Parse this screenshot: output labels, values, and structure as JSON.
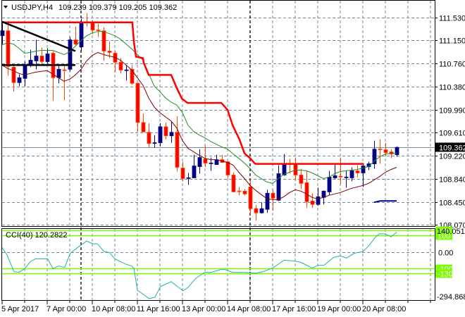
{
  "header": {
    "symbol_label": "USDJPY,H4",
    "ohlc": "109.239 109.379 109.205 109.362"
  },
  "colors": {
    "bull": "#000080",
    "bear_fill": "#ff0000",
    "bear_wick": "#ff4500",
    "stop_line": "#ff0000",
    "fast_ma": "#228b22",
    "slow_ma": "#800000",
    "trendline": "#000000",
    "cci_line": "#20b2aa",
    "cci_level": "#7cfc00",
    "grid": "#778899",
    "price_line": "#778899"
  },
  "chart_data": {
    "type": "candlestick",
    "symbol": "USDJPY",
    "timeframe": "H4",
    "ylim": [
      108.047,
      111.81
    ],
    "price_axis": {
      "ticks": [
        "111.530",
        "111.150",
        "110.760",
        "110.380",
        "109.990",
        "109.610",
        "109.220",
        "108.840",
        "108.450",
        "108.070"
      ]
    },
    "current_price": "109.362",
    "x_labels": [
      {
        "index": 0,
        "label": "5 Apr 2017"
      },
      {
        "index": 8,
        "label": "7 Apr 00:00"
      },
      {
        "index": 16,
        "label": "10 Apr 08:00"
      },
      {
        "index": 24,
        "label": "11 Apr 16:00"
      },
      {
        "index": 32,
        "label": "13 Apr 00:00"
      },
      {
        "index": 40,
        "label": "14 Apr 08:00"
      },
      {
        "index": 48,
        "label": "17 Apr 16:00"
      },
      {
        "index": 56,
        "label": "19 Apr 00:00"
      },
      {
        "index": 64,
        "label": "20 Apr 08:00"
      }
    ],
    "vertical_markers": [
      14,
      44
    ],
    "candles_ohlc": [
      [
        111.226,
        111.46,
        111.086,
        111.308
      ],
      [
        111.308,
        111.471,
        110.56,
        110.712
      ],
      [
        110.7,
        110.735,
        110.291,
        110.443
      ],
      [
        110.443,
        110.583,
        110.384,
        110.525
      ],
      [
        110.513,
        110.794,
        110.384,
        110.735
      ],
      [
        110.735,
        110.992,
        110.7,
        110.817
      ],
      [
        110.805,
        111.156,
        110.665,
        110.887
      ],
      [
        110.887,
        111.027,
        110.735,
        110.794
      ],
      [
        110.794,
        111.016,
        110.758,
        110.922
      ],
      [
        110.934,
        110.969,
        110.139,
        110.525
      ],
      [
        110.525,
        110.723,
        110.431,
        110.665
      ],
      [
        110.655,
        110.758,
        110.151,
        110.651
      ],
      [
        110.665,
        111.203,
        110.63,
        111.156
      ],
      [
        111.156,
        111.378,
        111.051,
        111.086
      ],
      [
        111.039,
        111.507,
        110.969,
        111.448
      ],
      [
        111.45,
        111.6,
        111.378,
        111.446
      ],
      [
        111.448,
        111.483,
        111.249,
        111.32
      ],
      [
        111.322,
        111.425,
        111.203,
        111.318
      ],
      [
        111.308,
        111.366,
        110.805,
        110.969
      ],
      [
        110.969,
        111.133,
        110.852,
        110.946
      ],
      [
        110.934,
        110.969,
        110.618,
        110.782
      ],
      [
        110.782,
        110.852,
        110.595,
        110.653
      ],
      [
        110.651,
        110.735,
        110.478,
        110.655
      ],
      [
        110.665,
        110.735,
        110.408,
        110.431
      ],
      [
        110.431,
        110.443,
        109.625,
        109.777
      ],
      [
        109.777,
        109.929,
        109.613,
        109.62
      ],
      [
        109.613,
        109.765,
        109.356,
        109.426
      ],
      [
        109.436,
        109.566,
        109.356,
        109.44
      ],
      [
        109.438,
        109.765,
        109.379,
        109.706
      ],
      [
        109.706,
        109.777,
        109.496,
        109.555
      ],
      [
        109.555,
        109.788,
        109.438,
        109.613
      ],
      [
        109.613,
        109.882,
        108.958,
        109.029
      ],
      [
        109.017,
        109.122,
        108.795,
        108.841
      ],
      [
        108.851,
        108.935,
        108.736,
        108.855
      ],
      [
        108.853,
        109.239,
        108.85,
        109.052
      ],
      [
        109.04,
        109.332,
        108.923,
        109.192
      ],
      [
        109.169,
        109.391,
        109.029,
        109.099
      ],
      [
        109.097,
        109.192,
        108.97,
        109.101
      ],
      [
        109.075,
        109.239,
        109.07,
        109.157
      ],
      [
        109.157,
        109.239,
        109.105,
        109.11
      ],
      [
        109.122,
        109.125,
        108.853,
        108.9
      ],
      [
        108.9,
        108.947,
        108.615,
        108.619
      ],
      [
        108.633,
        108.701,
        108.561,
        108.629
      ],
      [
        108.631,
        108.666,
        108.561,
        108.584
      ],
      [
        108.701,
        108.83,
        108.234,
        108.339
      ],
      [
        108.339,
        108.397,
        108.14,
        108.269
      ],
      [
        108.269,
        108.444,
        108.257,
        108.339
      ],
      [
        108.327,
        108.654,
        108.269,
        108.596
      ],
      [
        108.596,
        108.654,
        108.304,
        108.514
      ],
      [
        108.479,
        109.064,
        108.467,
        108.923
      ],
      [
        108.9,
        109.251,
        108.888,
        109.087
      ],
      [
        109.089,
        109.169,
        108.923,
        109.085
      ],
      [
        109.087,
        109.192,
        108.806,
        108.9
      ],
      [
        108.9,
        109.005,
        108.666,
        108.76
      ],
      [
        108.771,
        108.97,
        108.351,
        108.456
      ],
      [
        108.467,
        108.596,
        108.351,
        108.409
      ],
      [
        108.409,
        108.69,
        108.386,
        108.538
      ],
      [
        108.526,
        108.643,
        108.409,
        108.631
      ],
      [
        108.619,
        108.97,
        108.561,
        108.865
      ],
      [
        108.853,
        109.099,
        108.83,
        108.888
      ],
      [
        108.879,
        109.192,
        108.748,
        108.875
      ],
      [
        108.863,
        108.97,
        108.69,
        108.867
      ],
      [
        108.853,
        109.029,
        108.795,
        108.97
      ],
      [
        108.97,
        109.064,
        108.865,
        108.935
      ],
      [
        108.935,
        109.087,
        108.701,
        109.052
      ],
      [
        109.04,
        109.122,
        108.982,
        109.087
      ],
      [
        109.087,
        109.473,
        109.005,
        109.332
      ],
      [
        109.334,
        109.496,
        109.087,
        109.33
      ],
      [
        109.321,
        109.438,
        109.216,
        109.274
      ],
      [
        109.286,
        109.332,
        109.18,
        109.251
      ],
      [
        109.239,
        109.379,
        109.205,
        109.362
      ]
    ],
    "stop_line": [
      [
        0,
        111.448
      ],
      [
        23.1,
        111.448
      ],
      [
        23.4,
        111.109
      ],
      [
        23.75,
        110.875
      ],
      [
        25,
        110.852
      ],
      [
        25.1,
        110.78
      ],
      [
        26,
        110.571
      ],
      [
        30,
        110.571
      ],
      [
        31,
        110.349
      ],
      [
        31.9,
        110.174
      ],
      [
        32.9,
        110.104
      ],
      [
        38.9,
        110.104
      ],
      [
        40,
        109.987
      ],
      [
        40.9,
        109.73
      ],
      [
        42.1,
        109.496
      ],
      [
        43,
        109.262
      ],
      [
        44,
        109.181
      ],
      [
        44.9,
        109.087
      ],
      [
        64.2,
        109.087
      ]
    ],
    "fast_ma": [
      111.074,
      111.109,
      111.086,
      111.016,
      110.934,
      110.946,
      110.969,
      110.981,
      110.981,
      110.981,
      110.946,
      110.91,
      110.957,
      111.051,
      111.144,
      111.226,
      111.273,
      111.296,
      111.296,
      111.261,
      111.226,
      111.168,
      111.086,
      111.004,
      110.91,
      110.817,
      110.595,
      110.384,
      110.291,
      110.186,
      110.116,
      110.069,
      109.94,
      109.73,
      109.625,
      109.566,
      109.519,
      109.461,
      109.414,
      109.367,
      109.332,
      109.251,
      109.18,
      109.099,
      109.005,
      108.9,
      108.841,
      108.783,
      108.76,
      108.841,
      108.912,
      108.947,
      108.982,
      108.982,
      108.97,
      108.935,
      108.888,
      108.841,
      108.865,
      108.923,
      108.958,
      108.97,
      108.982,
      108.993,
      109.017,
      109.04,
      109.134,
      109.204,
      109.251,
      109.262,
      109.262
    ],
    "slow_ma": [
      110.735,
      110.677,
      110.642,
      110.595,
      110.571,
      110.595,
      110.618,
      110.63,
      110.642,
      110.583,
      110.525,
      110.466,
      110.501,
      110.571,
      110.665,
      110.805,
      110.899,
      110.946,
      110.91,
      110.887,
      110.864,
      110.817,
      110.735,
      110.653,
      110.525,
      110.396,
      110.186,
      110.034,
      109.94,
      109.87,
      109.8,
      109.683,
      109.473,
      109.344,
      109.286,
      109.227,
      109.18,
      109.157,
      109.157,
      109.134,
      109.11,
      109.064,
      108.947,
      108.841,
      108.725,
      108.643,
      108.573,
      108.502,
      108.491,
      108.491,
      108.538,
      108.608,
      108.654,
      108.631,
      108.584,
      108.526,
      108.502,
      108.526,
      108.561,
      108.584,
      108.608,
      108.643,
      108.678,
      108.701,
      108.725,
      108.76,
      108.818,
      108.877,
      108.947,
      108.993,
      109.029
    ],
    "trendlines": [
      {
        "kind": "descending",
        "points": [
          [
            0,
            111.46
          ],
          [
            13,
            110.969
          ]
        ]
      },
      {
        "kind": "horizontal",
        "points": [
          [
            0,
            110.735
          ],
          [
            13,
            110.735
          ]
        ]
      }
    ],
    "level_segment": [
      [
        66,
        108.444
      ],
      [
        67.1,
        108.467
      ],
      [
        70,
        108.467
      ]
    ]
  },
  "cci": {
    "label": "CCI(40) 120.2822",
    "ylim": [
      -294.8681,
      140.0513
    ],
    "axis_labels": {
      "max": "140.0513",
      "zero": "0.00",
      "min": "-294.8681"
    },
    "levels": [
      {
        "value": 130,
        "label": "130"
      },
      {
        "value": 100,
        "label": "100"
      },
      {
        "value": -100,
        "label": "-100"
      },
      {
        "value": -130,
        "label": "-130"
      }
    ],
    "series": [
      [
        0,
        27
      ],
      [
        0.9,
        -21
      ],
      [
        2.1,
        -121
      ],
      [
        3,
        -125
      ],
      [
        4,
        -103
      ],
      [
        5,
        -60
      ],
      [
        5.9,
        -43
      ],
      [
        7.5,
        -43
      ],
      [
        8.1,
        -43
      ],
      [
        9,
        -103
      ],
      [
        10,
        -86
      ],
      [
        11.1,
        -95
      ],
      [
        12.1,
        -8
      ],
      [
        13.4,
        27
      ],
      [
        15,
        66
      ],
      [
        16.1,
        49
      ],
      [
        16.9,
        49
      ],
      [
        18.1,
        1
      ],
      [
        19,
        -3
      ],
      [
        20,
        -43
      ],
      [
        21.3,
        -64
      ],
      [
        22.1,
        -77
      ],
      [
        23,
        -86
      ],
      [
        23.4,
        -103
      ],
      [
        24,
        -234
      ],
      [
        26.1,
        -286
      ],
      [
        27.1,
        -277
      ],
      [
        28.1,
        -212
      ],
      [
        30,
        -182
      ],
      [
        32.1,
        -238
      ],
      [
        33,
        -217
      ],
      [
        34.3,
        -164
      ],
      [
        35.9,
        -125
      ],
      [
        37.1,
        -125
      ],
      [
        38.8,
        -108
      ],
      [
        39.6,
        -108
      ],
      [
        40.9,
        -125
      ],
      [
        43,
        -125
      ],
      [
        45,
        -130
      ],
      [
        46.3,
        -121
      ],
      [
        48,
        -99
      ],
      [
        50,
        -51
      ],
      [
        51.8,
        -56
      ],
      [
        53,
        -64
      ],
      [
        55,
        -99
      ],
      [
        56.1,
        -82
      ],
      [
        57.1,
        -82
      ],
      [
        58.8,
        -34
      ],
      [
        60,
        -25
      ],
      [
        61.1,
        -38
      ],
      [
        62.5,
        -8
      ],
      [
        64,
        1
      ],
      [
        65,
        36
      ],
      [
        66.3,
        92
      ],
      [
        66.9,
        110
      ],
      [
        68,
        110
      ],
      [
        69,
        92
      ],
      [
        70,
        120.28
      ]
    ]
  }
}
